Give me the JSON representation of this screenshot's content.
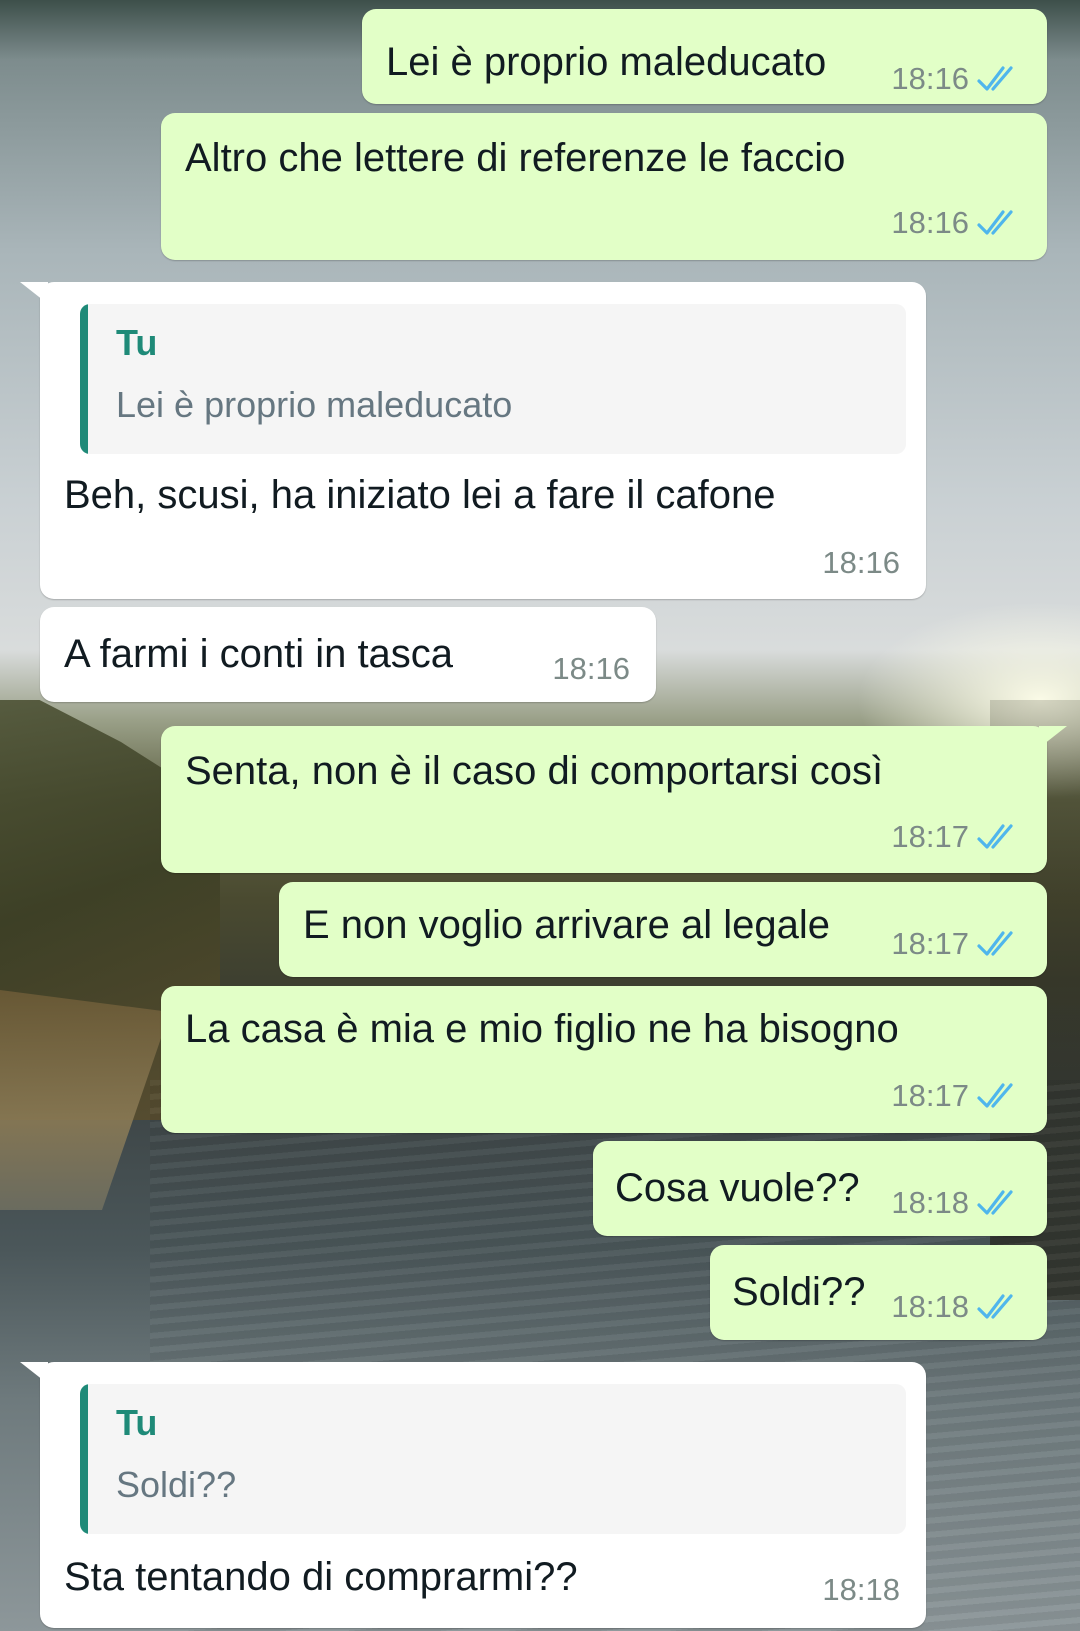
{
  "messages": [
    {
      "direction": "outgoing",
      "text": "Lei è proprio maleducato",
      "time": "18:16",
      "status": "read"
    },
    {
      "direction": "outgoing",
      "text": "Altro che lettere di referenze le faccio",
      "time": "18:16",
      "status": "read"
    },
    {
      "direction": "incoming",
      "reply": {
        "author": "Tu",
        "text": "Lei è proprio maleducato"
      },
      "text": "Beh, scusi, ha iniziato lei a fare il cafone",
      "time": "18:16"
    },
    {
      "direction": "incoming",
      "text": "A farmi i conti in tasca",
      "time": "18:16"
    },
    {
      "direction": "outgoing",
      "text": "Senta, non è il caso di comportarsi così",
      "time": "18:17",
      "status": "read"
    },
    {
      "direction": "outgoing",
      "text": "E non voglio arrivare al legale",
      "time": "18:17",
      "status": "read"
    },
    {
      "direction": "outgoing",
      "text": "La casa è mia e mio figlio ne ha bisogno",
      "time": "18:17",
      "status": "read"
    },
    {
      "direction": "outgoing",
      "text": "Cosa vuole??",
      "time": "18:18",
      "status": "read"
    },
    {
      "direction": "outgoing",
      "text": "Soldi??",
      "time": "18:18",
      "status": "read"
    },
    {
      "direction": "incoming",
      "reply": {
        "author": "Tu",
        "text": "Soldi??"
      },
      "text": "Sta tentando di comprarmi??",
      "time": "18:18"
    }
  ],
  "colors": {
    "outgoing_bubble": "#e2ffc7",
    "incoming_bubble": "#ffffff",
    "read_tick": "#4fb6ec",
    "reply_accent": "#1f8a78",
    "time_text": "#7c8a87"
  },
  "icons": {
    "status": "double-check-icon"
  }
}
